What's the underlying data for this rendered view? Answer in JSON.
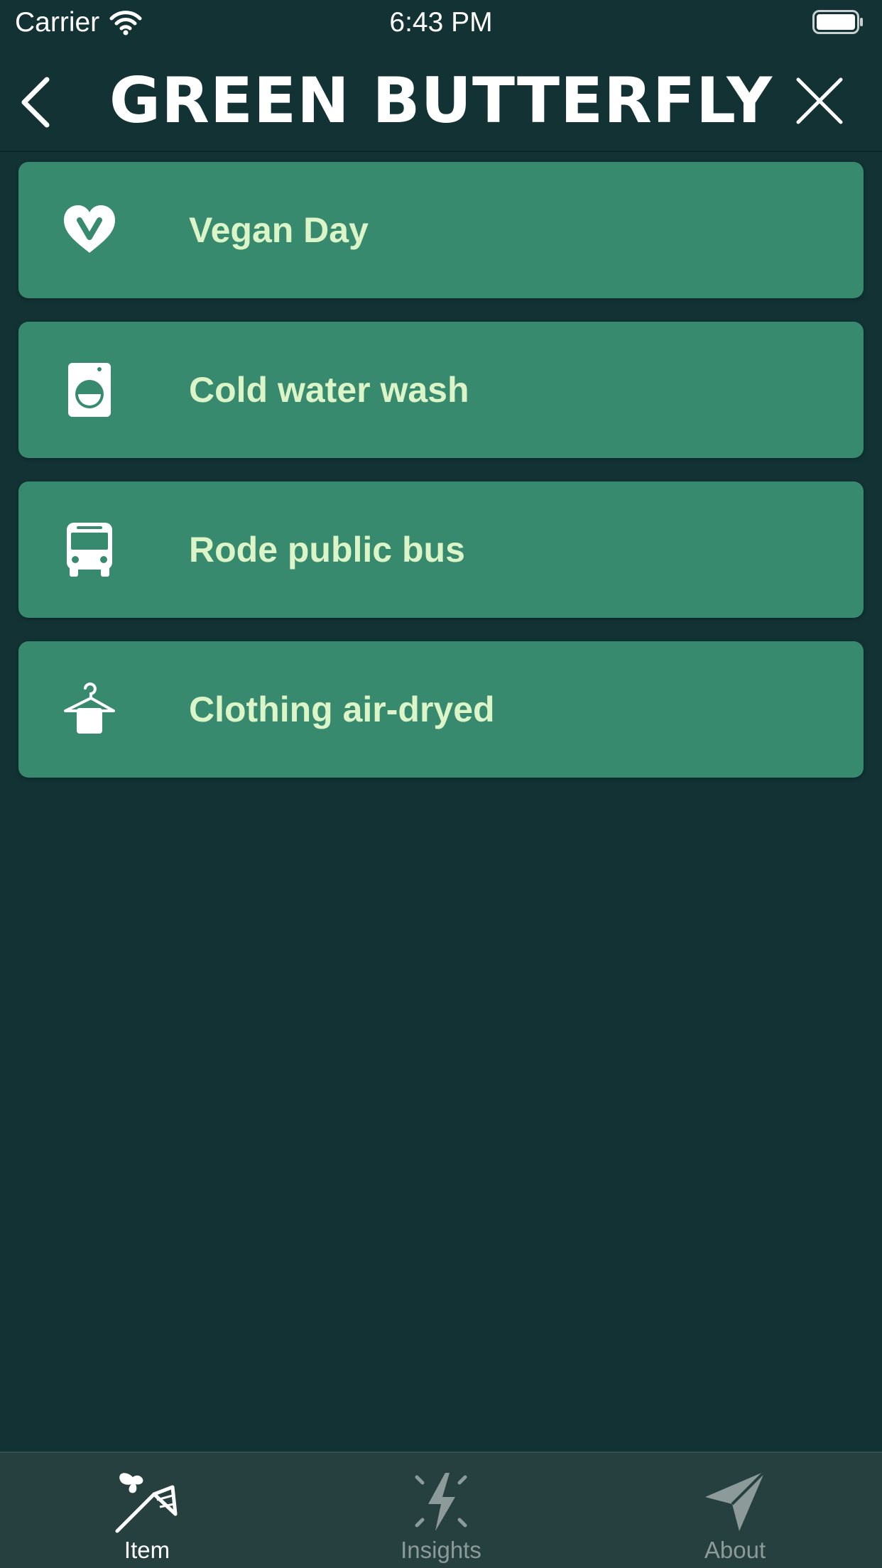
{
  "status_bar": {
    "carrier": "Carrier",
    "time": "6:43 PM",
    "wifi_icon": "wifi-icon",
    "battery_icon": "battery-full-icon"
  },
  "nav": {
    "title": "GREEN BUTTERFLY",
    "back_icon": "chevron-left-icon",
    "close_icon": "close-icon"
  },
  "items": [
    {
      "label": "Vegan Day",
      "icon": "vegan-heart-icon"
    },
    {
      "label": "Cold water wash",
      "icon": "washing-machine-icon"
    },
    {
      "label": "Rode public bus",
      "icon": "bus-icon"
    },
    {
      "label": "Clothing air-dryed",
      "icon": "hanger-icon"
    }
  ],
  "tabs": [
    {
      "label": "Item",
      "icon": "butterfly-net-icon",
      "active": true
    },
    {
      "label": "Insights",
      "icon": "lightning-icon",
      "active": false
    },
    {
      "label": "About",
      "icon": "paper-plane-icon",
      "active": false
    }
  ],
  "colors": {
    "background": "#123234",
    "card": "#388a6e",
    "card_text": "#dcf5c8",
    "tab_bar": "#264040",
    "tab_active": "#ffffff",
    "tab_inactive": "#8c9a9a"
  }
}
